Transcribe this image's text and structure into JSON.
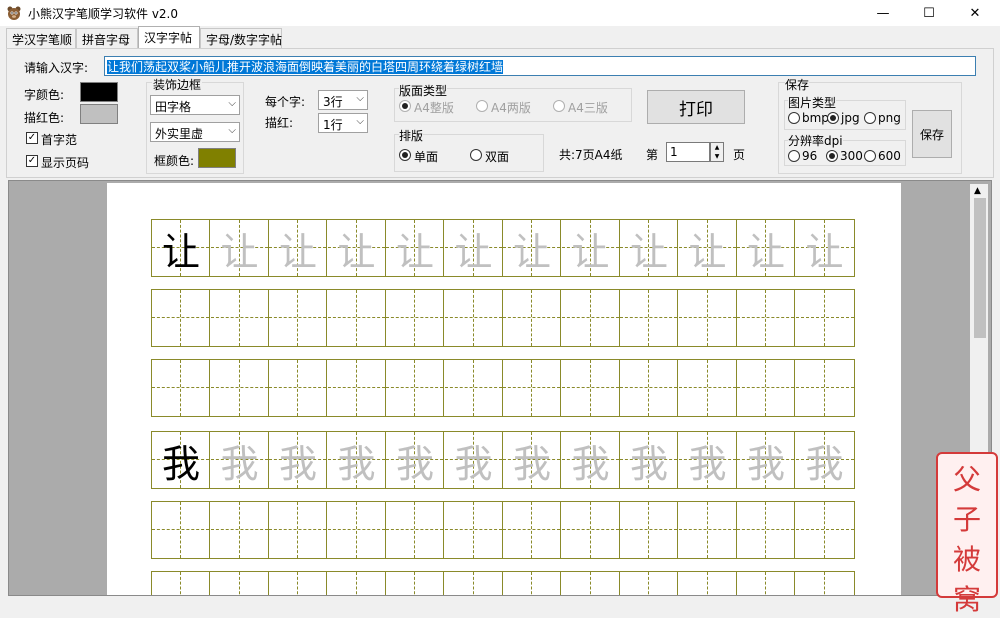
{
  "window": {
    "title": "小熊汉字笔顺学习软件 v2.0",
    "minimize": "—",
    "maximize": "☐",
    "close": "✕"
  },
  "tabs": [
    "学汉字笔顺",
    "拼音字母",
    "汉字字帖",
    "字母/数字字帖"
  ],
  "active_tab": 2,
  "form": {
    "input_label": "请输入汉字:",
    "input_value": "让我们荡起双桨小船儿推开波浪海面倒映着美丽的白塔四周环绕着绿树红墙",
    "char_color_label": "字颜色:",
    "char_color": "#000000",
    "trace_color_label": "描红色:",
    "trace_color": "#c0c0c0",
    "first_char_label": "首字范",
    "show_page_label": "显示页码",
    "border_group_label": "装饰边框",
    "grid_type": "田字格",
    "border_style": "外实里虚",
    "frame_color_label": "框颜色:",
    "frame_color": "#808000",
    "per_char_label": "每个字:",
    "per_char_value": "3行",
    "trace_label": "描红:",
    "trace_value": "1行",
    "page_type_label": "版面类型",
    "page_types": [
      "A4整版",
      "A4两版",
      "A4三版"
    ],
    "layout_label": "排版",
    "layout_single": "单面",
    "layout_double": "双面",
    "total_text": "共:7页A4纸",
    "page_prefix": "第",
    "page_value": "1",
    "page_suffix": "页",
    "print_label": "打印",
    "save_group_label": "保存",
    "image_type_label": "图片类型",
    "image_types": [
      "bmp",
      "jpg",
      "png"
    ],
    "dpi_label": "分辨率dpi",
    "dpi_options": [
      "96",
      "300",
      "600"
    ],
    "save_label": "保存"
  },
  "sheet": {
    "rows": [
      {
        "char": "让",
        "model": true
      },
      {
        "char": "",
        "model": false
      },
      {
        "char": "",
        "model": false
      },
      {
        "char": "我",
        "model": true
      },
      {
        "char": "",
        "model": false
      },
      {
        "char": "",
        "model": false
      }
    ],
    "cells_per_row": 12
  },
  "seal": {
    "chars": [
      "父",
      "子",
      "被",
      "窝"
    ]
  }
}
